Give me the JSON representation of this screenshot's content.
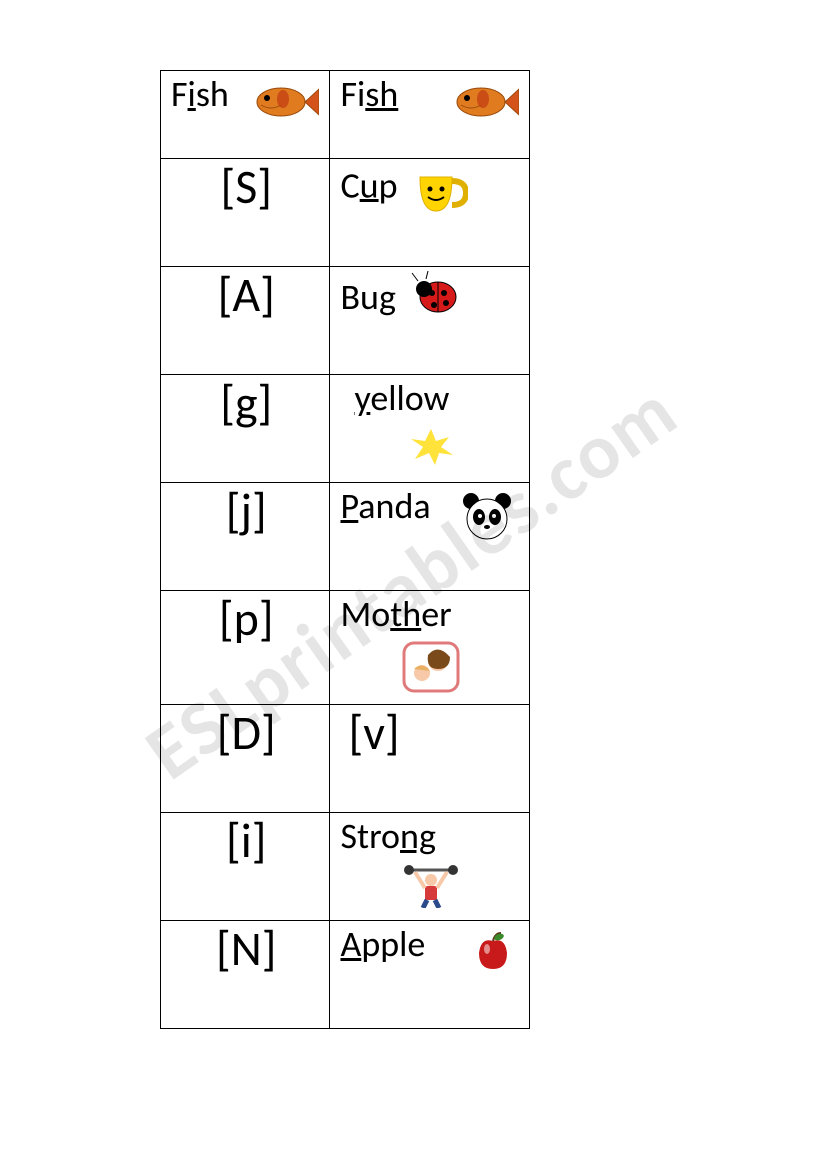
{
  "watermark": "ESLprintables.com",
  "rows": [
    {
      "left_pre": "F",
      "left_u": "i",
      "left_post": "sh",
      "left_icon": "fish",
      "right_pre": "Fi",
      "right_u": "sh",
      "right_post": "",
      "right_icon": "fish"
    },
    {
      "left_sym": "[S]",
      "right_pre": "C",
      "right_u": "u",
      "right_post": "p",
      "right_icon": "cup"
    },
    {
      "left_sym": "[A]",
      "right_pre": "Bu",
      "right_u": "g",
      "right_post": "",
      "right_icon": "bug"
    },
    {
      "left_sym": "[g]",
      "right_pre": "",
      "right_u": "y",
      "right_post": "ellow",
      "right_icon": "yellow"
    },
    {
      "left_sym": "[j]",
      "right_pre": "",
      "right_u": "P",
      "right_post": "anda",
      "right_icon": "panda"
    },
    {
      "left_sym": "[p]",
      "right_pre": "Mo",
      "right_u": "th",
      "right_post": "er",
      "right_icon": "mother"
    },
    {
      "left_sym": "[D]",
      "right_sym": "[v]"
    },
    {
      "left_sym": "[i]",
      "right_pre": "Stro",
      "right_u": "ng",
      "right_post": "",
      "right_icon": "strong"
    },
    {
      "left_sym": "[N]",
      "right_pre": "",
      "right_u": "A",
      "right_post": "pple",
      "right_icon": "apple"
    }
  ]
}
